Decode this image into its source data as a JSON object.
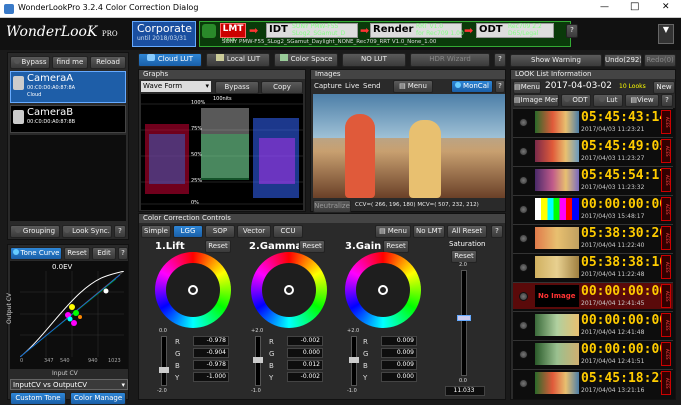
{
  "window": {
    "title": "WonderLookPro 3.2.4 Color Correction Dialog",
    "min": "—",
    "max": "□",
    "close": "✕"
  },
  "brand": {
    "name": "WonderLooK",
    "suffix": "PRO"
  },
  "header": {
    "project": "Corporate",
    "until": "until 2018/03/31",
    "lmt_label": "LMT",
    "lmt_sub": "Input",
    "idt_label": "IDT",
    "idt_line1": "SONY PMW-F55",
    "idt_line2": "SLog2_SGamut_D",
    "render_label": "Render",
    "render_line1": "RRT V1.0",
    "render_line2": "for Rec709 1.00",
    "odt_label": "ODT",
    "odt_line1": "Rec709 2.2",
    "odt_line2": "D65/Legal",
    "path": "SONY PMW-F55_SLog2_SGamut_Daylight_NONE_Rec709_RRT V1.0_None_1.00",
    "help": "?"
  },
  "cameras": {
    "bypass": "Bypass",
    "findme": "find me",
    "reload": "Reload",
    "a_name": "CameraA",
    "a_addr": "00:C0:D0:A0:87:8A",
    "a_cloud": "Cloud",
    "b_name": "CameraB",
    "b_addr": "00:C0:D0:A0:87:8B",
    "grouping": "Grouping",
    "looksync": "Look Sync.",
    "help": "?"
  },
  "curve": {
    "tab": "Tone Curve",
    "reset": "Reset",
    "edit": "Edit",
    "help": "?",
    "ev": "0.0EV",
    "xlabel": "Input CV",
    "ylabel": "Output CV",
    "ticks": [
      "0",
      "347",
      "540",
      "940",
      "1023"
    ],
    "mode": "InputCV vs OutputCV",
    "cbtn1": "Custom Tone",
    "cbtn2": "Color Manage"
  },
  "luttabs": {
    "cloud": "Cloud LUT",
    "local": "Local LUT",
    "colorspace": "Color Space",
    "nolut": "NO LUT",
    "hdr": "HDR Wizard",
    "help": "?"
  },
  "graphs": {
    "title": "Graphs",
    "mode": "Wave Form",
    "bypass": "Bypass",
    "copy": "Copy",
    "nits": "100nits",
    "pct": [
      "100%",
      "75%",
      "50%",
      "25%",
      "0%"
    ]
  },
  "images": {
    "title": "Images",
    "capture": "Capture",
    "live": "Live",
    "send": "Send",
    "menu": "Menu",
    "moncal": "MonCal",
    "neutralize": "Neutralize",
    "cv": "CCV=( 266, 196, 180) MCV=( 507, 232, 212)"
  },
  "cc": {
    "title": "Color Correction Controls",
    "tabs": [
      "Simple",
      "LGG",
      "SOP",
      "Vector",
      "CCU"
    ],
    "menu": "Menu",
    "nolmt": "No LMT",
    "allreset": "All Reset",
    "help": "?",
    "sat_title": "Saturation",
    "sat_reset": "Reset",
    "sat_val": "11.033",
    "sat_top": "2.0",
    "sat_bot": "0.0",
    "lift": {
      "title": "1.Lift",
      "reset": "Reset",
      "r": "-0.978",
      "g": "-0.904",
      "b": "-0.978",
      "y": "-1.000",
      "top": "0.0",
      "bot": "-2.0"
    },
    "gamma": {
      "title": "2.Gamma",
      "reset": "Reset",
      "r": "-0.002",
      "g": "0.000",
      "b": "0.012",
      "y": "-0.002",
      "top": "+2.0",
      "bot": "-1.0"
    },
    "gain": {
      "title": "3.Gain",
      "reset": "Reset",
      "r": "0.009",
      "g": "0.009",
      "b": "0.009",
      "y": "0.000",
      "top": "+2.0",
      "bot": "-1.0"
    }
  },
  "looks": {
    "warning": "Show Warning",
    "undo": "Undo(292)",
    "redo": "Redo(0)",
    "title": "LOOK List Information",
    "menu": "Menu",
    "date": "2017-04-03-02",
    "count": "10 Looks",
    "new": "New",
    "imgmenu": "Image Menu",
    "odt": "ODT",
    "lut": "Lut",
    "view": "View",
    "help": "?",
    "noimage": "No Image",
    "aces": "ACES",
    "items": [
      {
        "tc": "05:45:43:14",
        "ts": "2017/04/03 11:23:21",
        "th": "t1"
      },
      {
        "tc": "05:45:49:05",
        "ts": "2017/04/03 11:23:27",
        "th": "t2"
      },
      {
        "tc": "05:45:54:17",
        "ts": "2017/04/03 11:23:32",
        "th": "t3"
      },
      {
        "tc": "00:00:00:00",
        "ts": "2017/04/03 15:48:17",
        "th": "bars"
      },
      {
        "tc": "05:38:30:20",
        "ts": "2017/04/04 11:22:40",
        "th": "t4"
      },
      {
        "tc": "05:38:38:10",
        "ts": "2017/04/04 11:22:48",
        "th": "t5"
      },
      {
        "tc": "00:00:00:00",
        "ts": "2017/04/04 12:41:45",
        "th": "none"
      },
      {
        "tc": "00:00:00:00",
        "ts": "2017/04/04 12:41:48",
        "th": "t6"
      },
      {
        "tc": "00:00:00:00",
        "ts": "2017/04/04 12:41:51",
        "th": "t7"
      },
      {
        "tc": "05:45:18:21",
        "ts": "2017/04/04 13:21:16",
        "th": "t8"
      }
    ]
  }
}
